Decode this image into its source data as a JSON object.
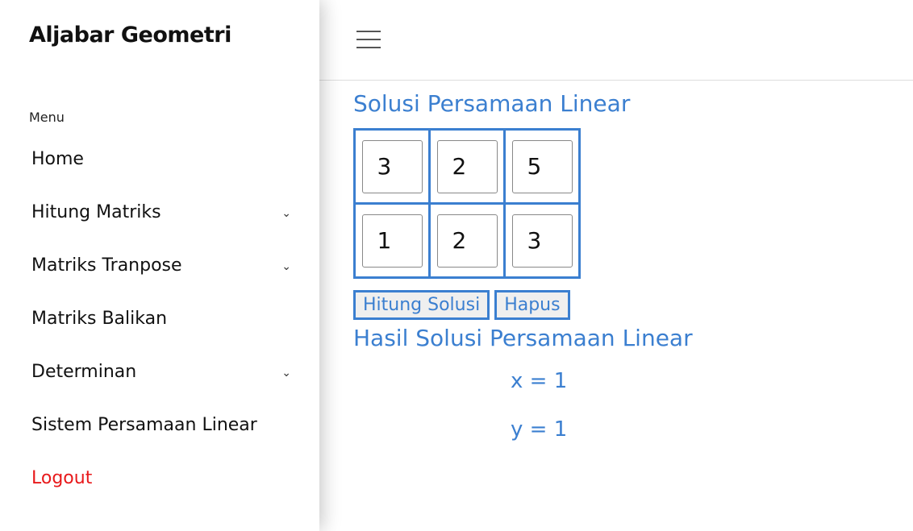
{
  "sidebar": {
    "brand": "Aljabar Geometri",
    "menu_label": "Menu",
    "items": [
      {
        "label": "Home"
      },
      {
        "label": "Hitung Matriks"
      },
      {
        "label": "Matriks Tranpose"
      },
      {
        "label": "Matriks Balikan"
      },
      {
        "label": "Determinan"
      },
      {
        "label": "Sistem Persamaan Linear"
      },
      {
        "label": "Logout"
      }
    ],
    "chevron": "⌄"
  },
  "main": {
    "title": "Solusi Persamaan Linear",
    "matrix": [
      [
        "3",
        "2",
        "5"
      ],
      [
        "1",
        "2",
        "3"
      ]
    ],
    "compute_label": "Hitung Solusi",
    "clear_label": "Hapus",
    "result_title": "Hasil Solusi Persamaan Linear",
    "results": [
      "x = 1",
      "y = 1"
    ]
  },
  "colors": {
    "accent": "#3b7fd0",
    "logout": "#e8191b"
  }
}
